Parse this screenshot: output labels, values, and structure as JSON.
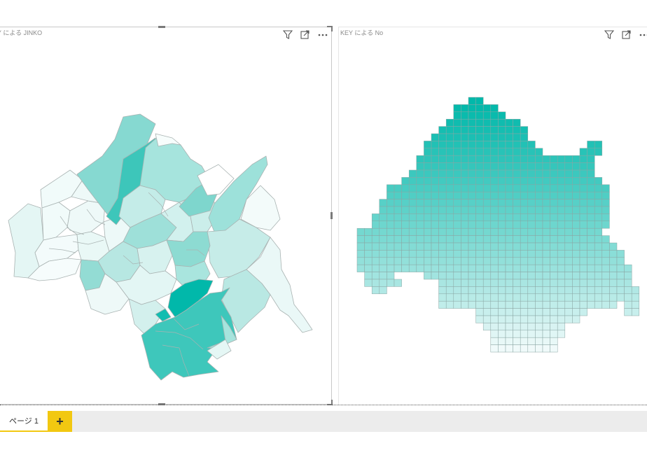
{
  "visuals": {
    "left": {
      "title": "Y による JINKO",
      "icons": [
        "filter-icon",
        "focus-mode-icon",
        "more-options-icon"
      ]
    },
    "right": {
      "title": "KEY による No",
      "icons": [
        "filter-icon",
        "focus-mode-icon",
        "more-options-icon"
      ]
    }
  },
  "pages": {
    "tabs": [
      {
        "label": "ページ 1",
        "selected": true
      }
    ],
    "add_label": "+"
  },
  "colors": {
    "accent": "#01b8aa",
    "page_tab_accent": "#f2c811",
    "map_light": "#eaf7f6"
  }
}
